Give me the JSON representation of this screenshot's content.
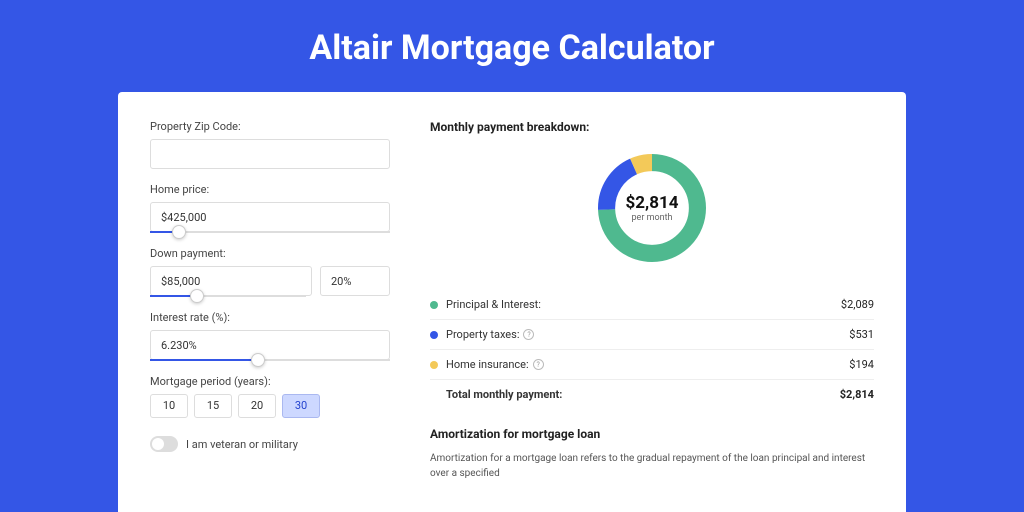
{
  "title": "Altair Mortgage Calculator",
  "form": {
    "zip_label": "Property Zip Code:",
    "zip_value": "",
    "home_price_label": "Home price:",
    "home_price_value": "$425,000",
    "home_price_slider_percent": 12,
    "down_payment_label": "Down payment:",
    "down_payment_value": "$85,000",
    "down_payment_pct": "20%",
    "down_payment_slider_percent": 30,
    "interest_label": "Interest rate (%):",
    "interest_value": "6.230%",
    "interest_slider_percent": 45,
    "period_label": "Mortgage period (years):",
    "periods": [
      {
        "label": "10",
        "active": false
      },
      {
        "label": "15",
        "active": false
      },
      {
        "label": "20",
        "active": false
      },
      {
        "label": "30",
        "active": true
      }
    ],
    "veteran_label": "I am veteran or military",
    "veteran_on": false
  },
  "breakdown": {
    "title": "Monthly payment breakdown:",
    "total_amount": "$2,814",
    "total_label": "per month",
    "items": [
      {
        "name": "Principal & Interest:",
        "value": "$2,089",
        "color": "dot-green",
        "info": false
      },
      {
        "name": "Property taxes:",
        "value": "$531",
        "color": "dot-blue",
        "info": true
      },
      {
        "name": "Home insurance:",
        "value": "$194",
        "color": "dot-yellow",
        "info": true
      }
    ],
    "total_row_label": "Total monthly payment:",
    "total_row_value": "$2,814"
  },
  "chart_data": {
    "type": "pie",
    "title": "Monthly payment breakdown",
    "series": [
      {
        "name": "Principal & Interest",
        "value": 2089,
        "color": "#4fb98f"
      },
      {
        "name": "Property taxes",
        "value": 531,
        "color": "#3456e6"
      },
      {
        "name": "Home insurance",
        "value": 194,
        "color": "#f3c959"
      }
    ],
    "total": 2814,
    "donut_inner_ratio": 0.62
  },
  "amortization": {
    "title": "Amortization for mortgage loan",
    "text": "Amortization for a mortgage loan refers to the gradual repayment of the loan principal and interest over a specified"
  }
}
